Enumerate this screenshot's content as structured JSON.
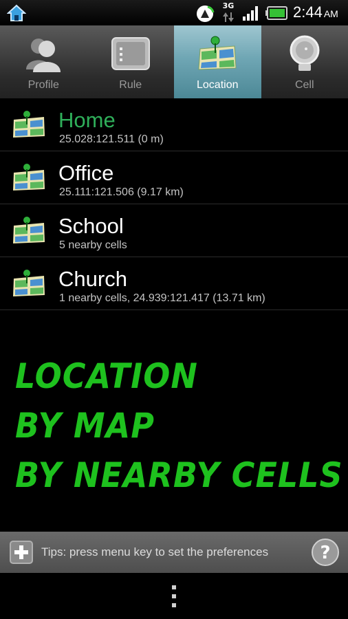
{
  "status_bar": {
    "network": "3G",
    "time": "2:44",
    "ampm": "AM",
    "icons": [
      "home-icon",
      "sync-icon",
      "data-arrows-icon",
      "signal-icon",
      "battery-icon"
    ]
  },
  "tabs": [
    {
      "label": "Profile",
      "icon": "profile-icon",
      "active": false
    },
    {
      "label": "Rule",
      "icon": "rule-icon",
      "active": false
    },
    {
      "label": "Location",
      "icon": "location-map-icon",
      "active": true
    },
    {
      "label": "Cell",
      "icon": "cell-icon",
      "active": false
    }
  ],
  "locations": [
    {
      "name": "Home",
      "detail": "25.028:121.511  (0 m)",
      "selected": true
    },
    {
      "name": "Office",
      "detail": "25.111:121.506  (9.17 km)",
      "selected": false
    },
    {
      "name": "School",
      "detail": "5 nearby cells",
      "selected": false
    },
    {
      "name": "Church",
      "detail": "1 nearby cells, 24.939:121.417  (13.71 km)",
      "selected": false
    }
  ],
  "promo": {
    "line1": "Location",
    "line2": "by map",
    "line3": "by nearby cells"
  },
  "tips": {
    "text": "Tips: press menu key to set the preferences"
  },
  "colors": {
    "accent_green": "#2faf5a",
    "promo_green": "#1ec11e",
    "active_tab": "#6fa6b4"
  }
}
